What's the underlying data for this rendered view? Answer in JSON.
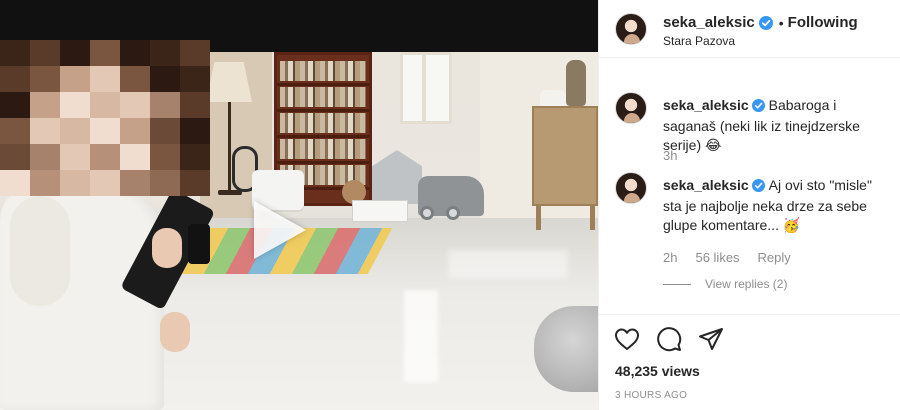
{
  "header": {
    "username": "seka_aleksic",
    "separator": "•",
    "follow_state": "Following",
    "location": "Stara Pazova"
  },
  "comments": [
    {
      "username": "seka_aleksic",
      "text": "Babaroga i saganaš (neki lik iz tinejdzerske serije)",
      "emoji": "😂",
      "time": "3h"
    },
    {
      "username": "seka_aleksic",
      "text": "Aj ovi sto \"misle\" sta je najbolje neka drze za sebe glupe komentare...",
      "emoji": "🥳",
      "time": "2h",
      "likes": "56 likes",
      "reply_label": "Reply",
      "view_replies": "View replies (2)"
    }
  ],
  "actions": {
    "like_icon": "heart-icon",
    "comment_icon": "comment-icon",
    "share_icon": "share-icon"
  },
  "stats": {
    "views": "48,235 views",
    "posted": "3 HOURS AGO"
  },
  "colors": {
    "verified": "#3897f0",
    "muted": "#8e8e8e",
    "text": "#262626",
    "divider": "#efefef"
  }
}
